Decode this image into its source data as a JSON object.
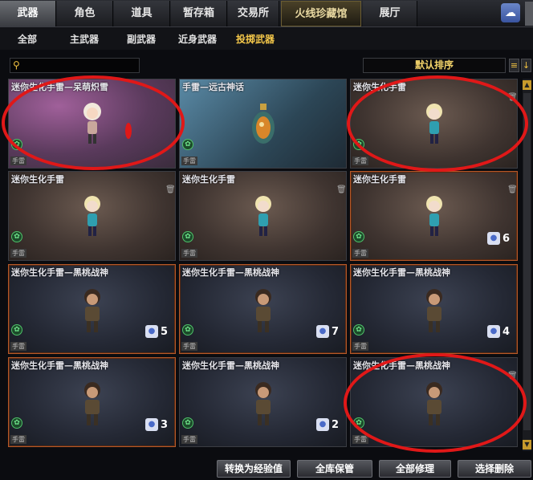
{
  "top_tabs": [
    "武器",
    "角色",
    "道具",
    "暂存箱",
    "交易所",
    "火线珍藏馆",
    "展厅"
  ],
  "sub_tabs": [
    "全部",
    "主武器",
    "副武器",
    "近身武器",
    "投掷武器"
  ],
  "search": {
    "placeholder": ""
  },
  "sort": {
    "label": "默认排序"
  },
  "cards": [
    {
      "title": "迷你生化手雷—呆萌炽雪",
      "tag": "手雷",
      "count": ""
    },
    {
      "title": "手雷—远古神话",
      "tag": "手雷",
      "count": ""
    },
    {
      "title": "迷你生化手雷",
      "tag": "手雷",
      "count": ""
    },
    {
      "title": "迷你生化手雷",
      "tag": "手雷",
      "count": ""
    },
    {
      "title": "迷你生化手雷",
      "tag": "手雷",
      "count": ""
    },
    {
      "title": "迷你生化手雷",
      "tag": "手雷",
      "count": "6"
    },
    {
      "title": "迷你生化手雷—黑桃战神",
      "tag": "手雷",
      "count": "5"
    },
    {
      "title": "迷你生化手雷—黑桃战神",
      "tag": "手雷",
      "count": "7"
    },
    {
      "title": "迷你生化手雷—黑桃战神",
      "tag": "手雷",
      "count": "4"
    },
    {
      "title": "迷你生化手雷—黑桃战神",
      "tag": "手雷",
      "count": "3"
    },
    {
      "title": "迷你生化手雷—黑桃战神",
      "tag": "手雷",
      "count": "2"
    },
    {
      "title": "迷你生化手雷—黑桃战神",
      "tag": "手雷",
      "count": ""
    }
  ],
  "buttons": {
    "convert": "转换为经验值",
    "store_all": "全库保管",
    "repair_all": "全部修理",
    "select_delete": "选择删除"
  },
  "colors": {
    "active_subtab": "#f5c84a",
    "annotation": "#e01818",
    "highlight_border": "#b5592a"
  }
}
